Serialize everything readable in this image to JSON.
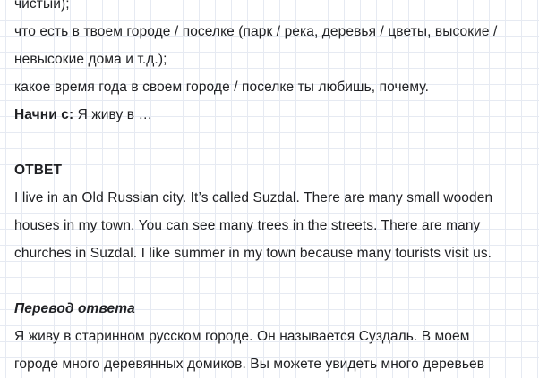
{
  "task": {
    "lines": [
      "чистый);",
      "что есть в твоем городе / поселке (парк / река, деревья / цветы, высокие /",
      "невысокие дома и т.д.);",
      "какое время года в своем городе / поселке ты любишь, почему."
    ],
    "start_label": "Начни с:",
    "start_text": " Я живу в …"
  },
  "answer": {
    "heading": "ОТВЕТ",
    "lines": [
      "I live in an Old Russian city. It’s called Suzdal. There are many small wooden",
      "houses in my town. You can see many trees in the streets. There are many",
      "churches in Suzdal. I like summer in my town because many tourists visit us."
    ]
  },
  "translation": {
    "heading": "Перевод ответа",
    "lines": [
      "Я живу в старинном русском городе. Он называется Суздаль. В моем",
      "городе много деревянных домиков. Вы можете увидеть много деревьев"
    ]
  }
}
